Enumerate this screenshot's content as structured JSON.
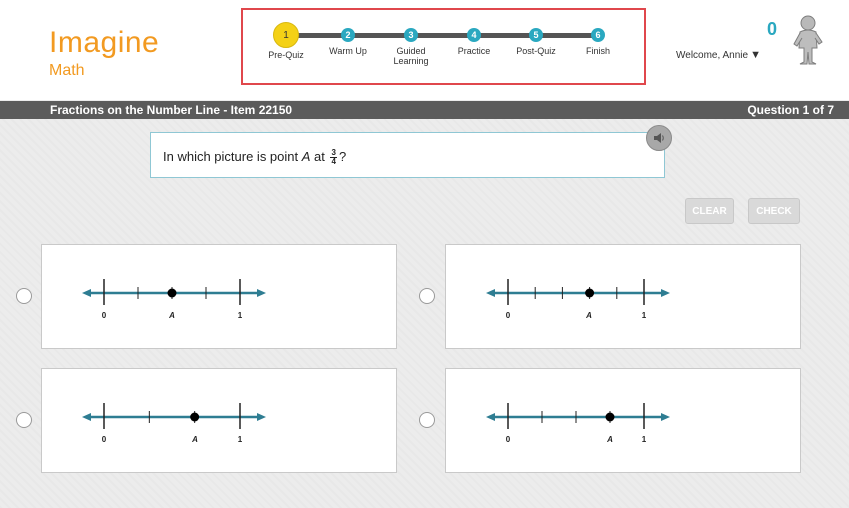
{
  "logo": {
    "line1": "Imagine",
    "line2": "Math"
  },
  "progress": {
    "steps": [
      {
        "num": "1",
        "label": "Pre-Quiz",
        "active": true
      },
      {
        "num": "2",
        "label": "Warm Up"
      },
      {
        "num": "3",
        "label": "Guided Learning"
      },
      {
        "num": "4",
        "label": "Practice"
      },
      {
        "num": "5",
        "label": "Post-Quiz"
      },
      {
        "num": "6",
        "label": "Finish"
      }
    ]
  },
  "user": {
    "score": "0",
    "welcome": "Welcome, Annie",
    "menu_caret": "▼"
  },
  "titlebar": {
    "lesson": "Fractions on the Number Line - Item 22150",
    "question_count": "Question 1 of 7"
  },
  "question": {
    "prefix": "In which picture is point ",
    "point": "A",
    "mid": " at ",
    "frac_num": "3",
    "frac_den": "4",
    "suffix": "?"
  },
  "buttons": {
    "clear": "CLEAR",
    "check": "CHECK"
  },
  "choices": [
    {
      "zero": "0",
      "point": "A",
      "one": "1",
      "divisions": 4,
      "point_at": 2
    },
    {
      "zero": "0",
      "point": "A",
      "one": "1",
      "divisions": 5,
      "point_at": 3
    },
    {
      "zero": "0",
      "point": "A",
      "one": "1",
      "divisions": 3,
      "point_at": 2
    },
    {
      "zero": "0",
      "point": "A",
      "one": "1",
      "divisions": 4,
      "point_at": 3
    }
  ],
  "colors": {
    "brand": "#f29a21",
    "accent": "#2aa8c0",
    "active_step": "#f4d116",
    "line": "#2e7d92",
    "highlight": "#e0474c"
  }
}
